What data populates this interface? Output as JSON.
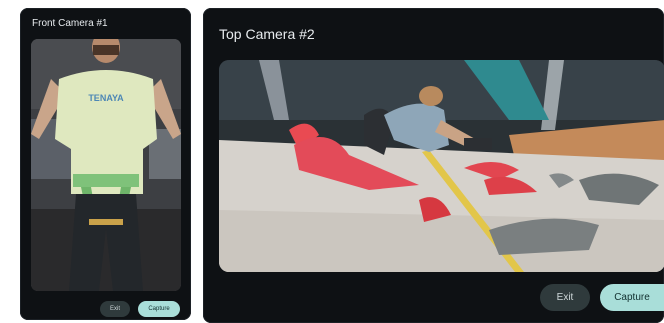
{
  "cameras": [
    {
      "title": "Front Camera #1",
      "feed_content": "person wearing climbing harness facing camera",
      "shirt_text": "TENAYA",
      "buttons": {
        "exit_label": "Exit",
        "capture_label": "Capture"
      }
    },
    {
      "title": "Top Camera #2",
      "feed_content": "climber on bouldering wall viewed from above",
      "buttons": {
        "exit_label": "Exit",
        "capture_label": "Capture"
      }
    }
  ],
  "colors": {
    "panel_bg": "#0e1114",
    "title_text": "#e8ecef",
    "exit_button": "#2f3a3c",
    "capture_button": "#a9ded9"
  }
}
